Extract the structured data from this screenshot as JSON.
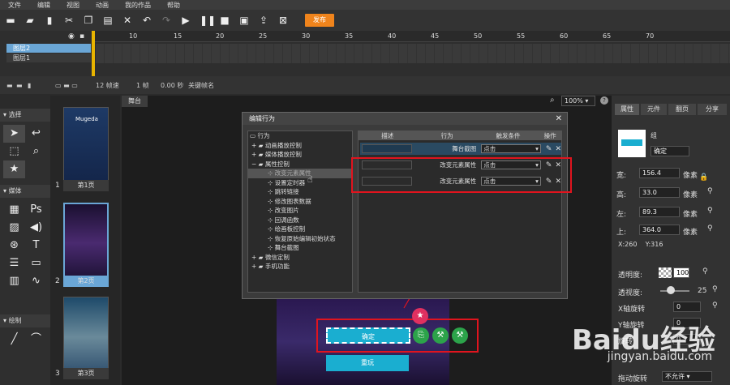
{
  "menu": [
    "文件",
    "编辑",
    "视图",
    "动画",
    "我的作品",
    "帮助"
  ],
  "toolbar": {
    "publish": "发布"
  },
  "timeline": {
    "ticks": [
      "10",
      "15",
      "20",
      "25",
      "30",
      "35",
      "40",
      "45",
      "50",
      "55",
      "60",
      "65",
      "70"
    ],
    "layers": [
      "图层2",
      "图层1"
    ],
    "fps": "12 帧速",
    "frame": "1 帧",
    "seconds": "0.00 秒",
    "keyframe_label": "关键帧名"
  },
  "left_panel": {
    "select": "选择",
    "media": "媒体",
    "draw": "绘制"
  },
  "pages": [
    {
      "num": "1",
      "label": "第1页",
      "brand": "Mugeda"
    },
    {
      "num": "2",
      "label": "第2页"
    },
    {
      "num": "3",
      "label": "第3页"
    }
  ],
  "stage": {
    "tab": "舞台",
    "zoom": "100%"
  },
  "dialog": {
    "title": "编辑行为",
    "tree": [
      "行为",
      "动画播放控制",
      "媒体播放控制",
      "属性控制",
      "改变元素属性",
      "设置定时器",
      "跳转链接",
      "修改图表数据",
      "改变图片",
      "回调函数",
      "绘画板控制",
      "恢复原始编辑初始状态",
      "舞台截图",
      "微信定制",
      "手机功能"
    ],
    "columns": [
      "描述",
      "行为",
      "触发条件",
      "操作"
    ],
    "rows": [
      {
        "action": "舞台截图",
        "trigger": "点击"
      },
      {
        "action": "改变元素属性",
        "trigger": "点击"
      },
      {
        "action": "改变元素属性",
        "trigger": "点击"
      }
    ]
  },
  "canvas": {
    "confirm": "确定",
    "reset": "重玩"
  },
  "right_panel": {
    "tabs": [
      "属性",
      "元件",
      "翻页",
      "分享"
    ],
    "element": {
      "group": "组",
      "name": "确定"
    },
    "width": {
      "label": "宽:",
      "value": "156.4",
      "unit": "像素"
    },
    "height": {
      "label": "高:",
      "value": "33.0",
      "unit": "像素"
    },
    "left": {
      "label": "左:",
      "value": "89.3",
      "unit": "像素"
    },
    "top": {
      "label": "上:",
      "value": "364.0",
      "unit": "像素"
    },
    "coords": "X:260    Y:316",
    "opacity": {
      "label": "透明度:",
      "value": "100"
    },
    "blur": {
      "label": "透视度:",
      "value": "25"
    },
    "rotate_x": {
      "label": "X轴旋转",
      "value": "0"
    },
    "rotate_y": {
      "label": "Y轴旋转",
      "value": "0"
    },
    "rotate_z": {
      "label": "旋转",
      "value": "0"
    },
    "drag": {
      "label": "拖动旋转",
      "value": "不允许"
    }
  },
  "watermark": {
    "brand": "Baidu经验",
    "url": "jingyan.baidu.com"
  },
  "colors": {
    "accent": "#f0841c",
    "button": "#1aaed0",
    "highlight": "#e0141e",
    "selection": "#6aa6d6"
  }
}
